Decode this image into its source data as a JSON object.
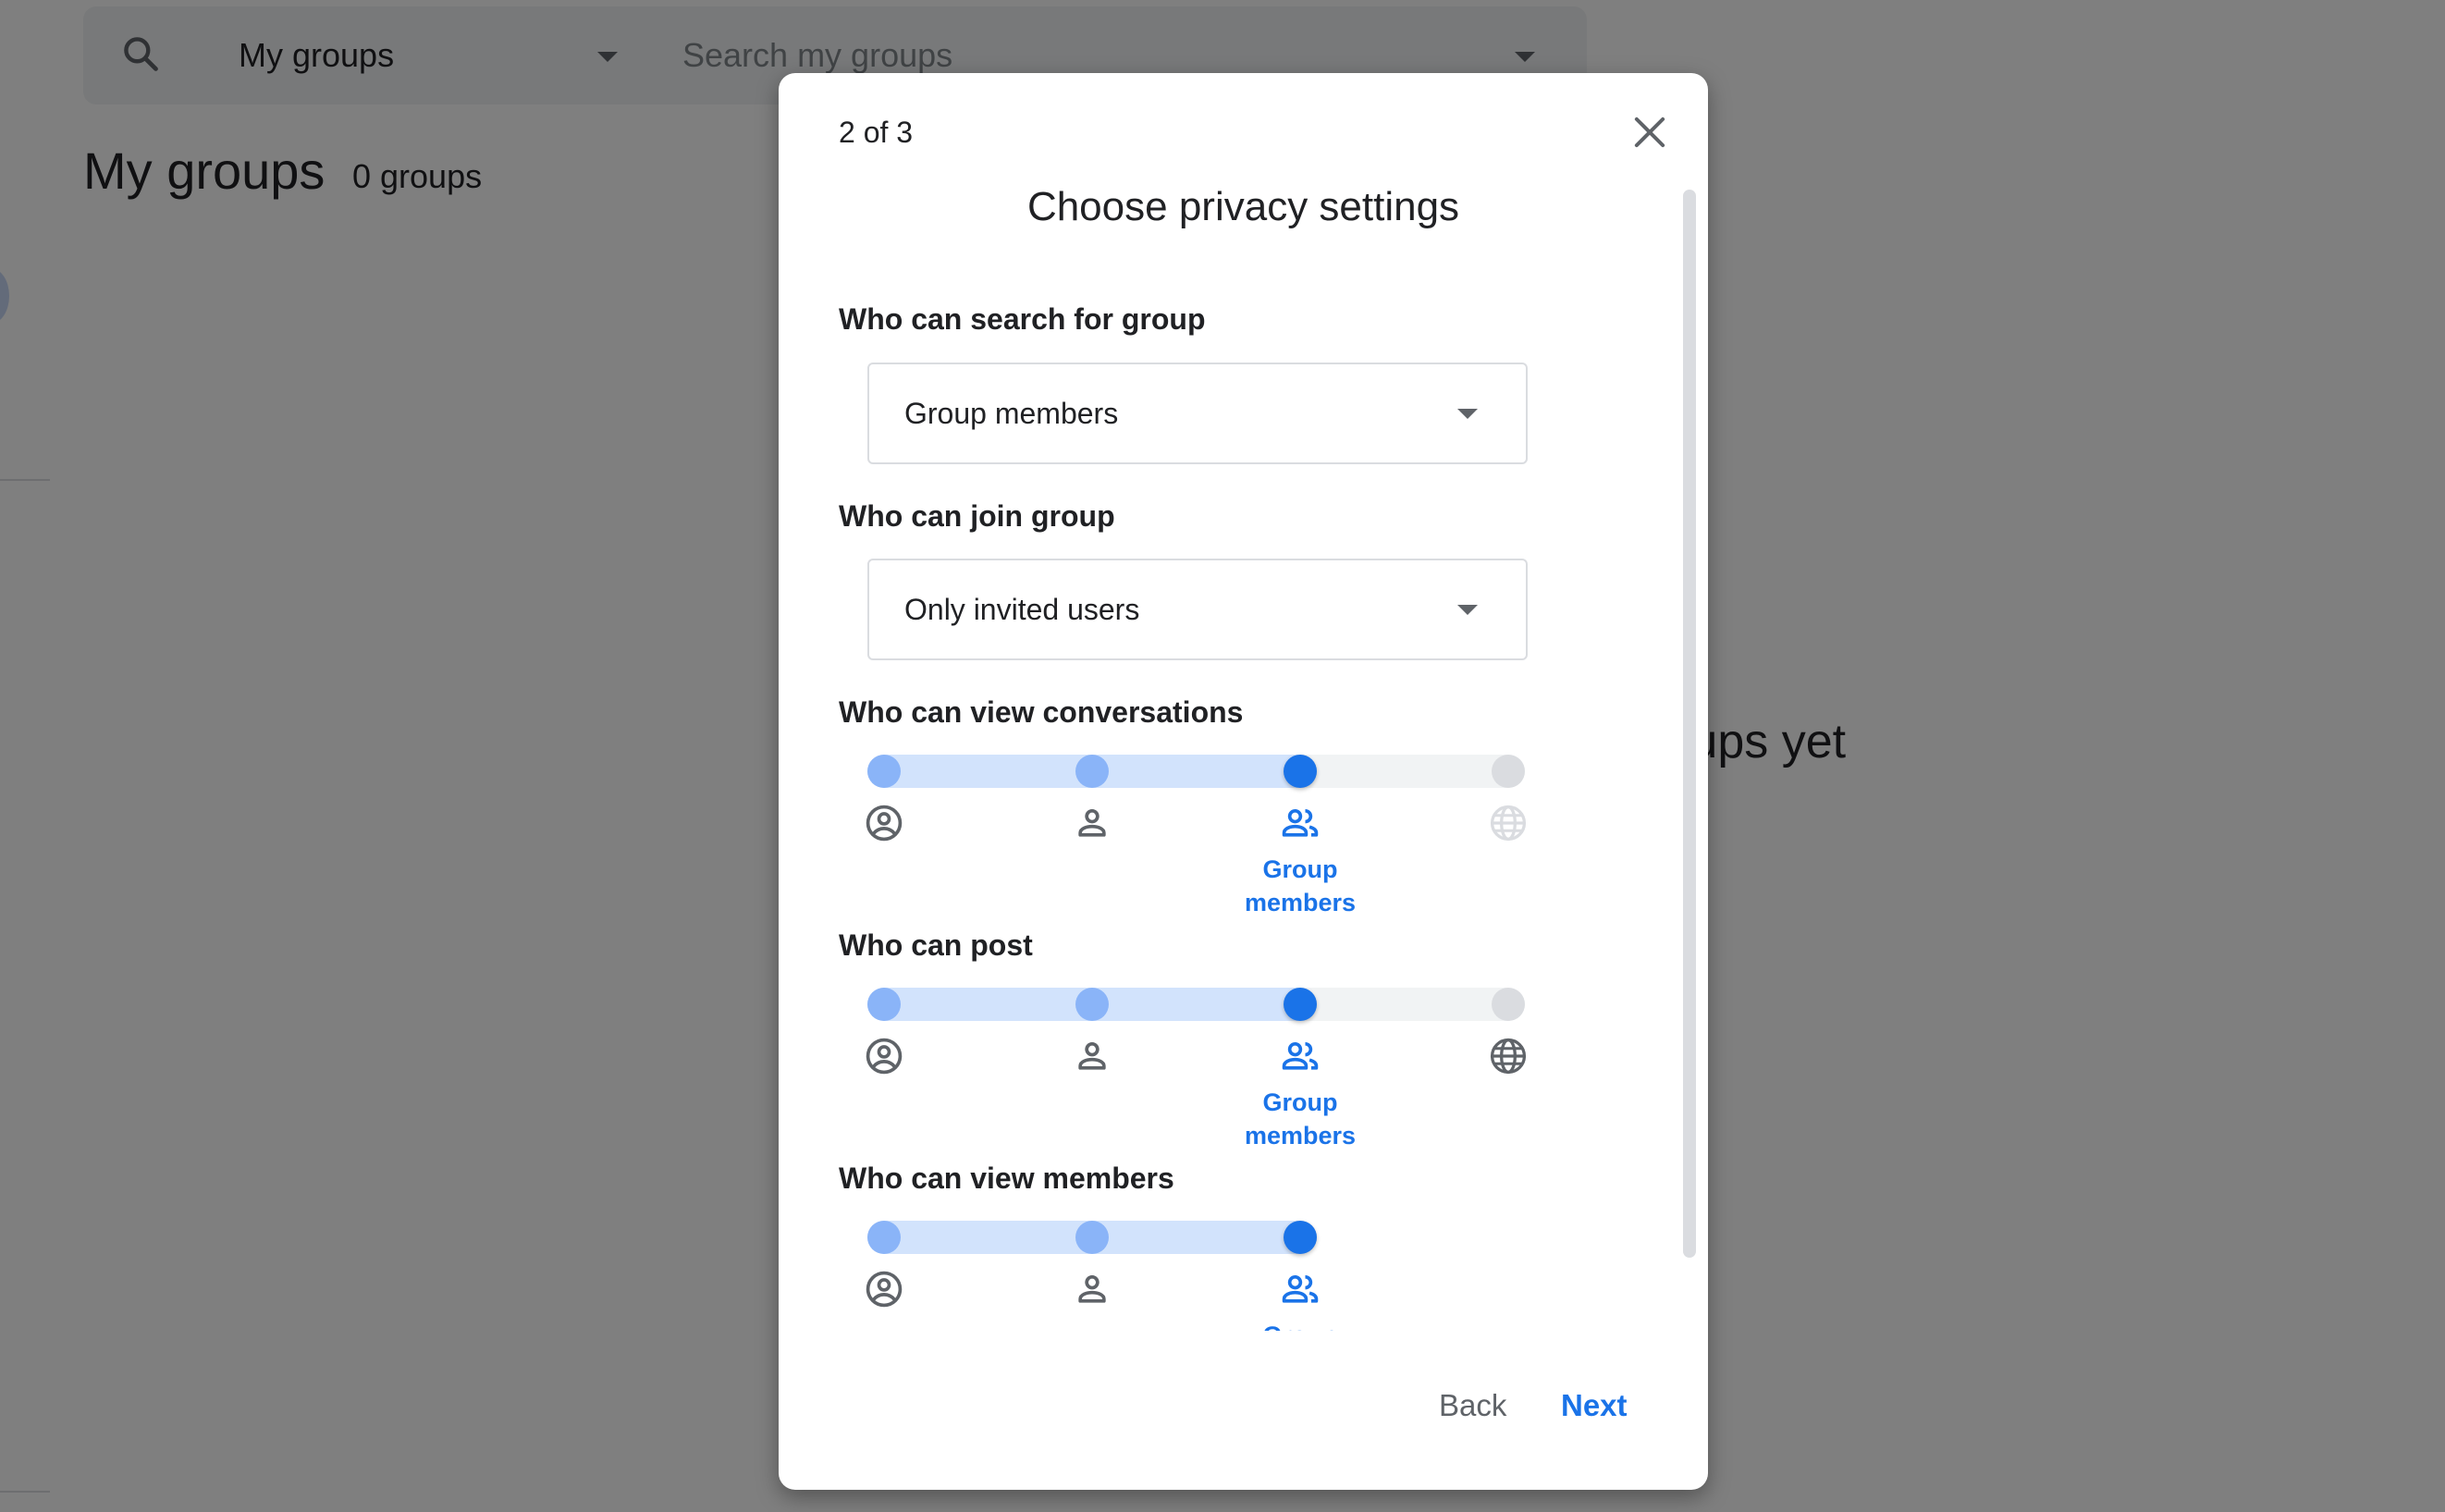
{
  "background": {
    "search": {
      "scope_selected": "My groups",
      "placeholder": "Search my groups",
      "value": ""
    },
    "page_title": "My groups",
    "group_count": "0 groups",
    "empty_state_text": "You don't have any groups yet"
  },
  "dialog": {
    "step": "2 of 3",
    "title": "Choose privacy settings",
    "fields": {
      "search_group": {
        "label": "Who can search for group",
        "value": "Group members"
      },
      "join_group": {
        "label": "Who can join group",
        "value": "Only invited users"
      }
    },
    "sliders": [
      {
        "label": "Who can view conversations",
        "options": [
          {
            "icon": "account-circle-icon",
            "enabled": true
          },
          {
            "icon": "person-icon",
            "enabled": true
          },
          {
            "icon": "group-icon",
            "enabled": true,
            "label": "Group members"
          },
          {
            "icon": "globe-icon",
            "enabled": false
          }
        ],
        "selected_index": 2
      },
      {
        "label": "Who can post",
        "options": [
          {
            "icon": "account-circle-icon",
            "enabled": true
          },
          {
            "icon": "person-icon",
            "enabled": true
          },
          {
            "icon": "group-icon",
            "enabled": true,
            "label": "Group members"
          },
          {
            "icon": "globe-icon",
            "enabled": true
          }
        ],
        "selected_index": 2
      },
      {
        "label": "Who can view members",
        "options": [
          {
            "icon": "account-circle-icon",
            "enabled": true
          },
          {
            "icon": "person-icon",
            "enabled": true
          },
          {
            "icon": "group-icon",
            "enabled": true,
            "label": "Group members"
          }
        ],
        "selected_index": 2
      }
    ],
    "buttons": {
      "back": "Back",
      "next": "Next"
    }
  },
  "colors": {
    "accent": "#1a73e8",
    "track_active": "#d2e3fc",
    "track_inactive": "#f1f3f4",
    "knot_passed": "#8ab4f8",
    "knot_disabled": "#dadce0",
    "icon_default": "#5f6368",
    "icon_disabled": "#dadce0"
  }
}
